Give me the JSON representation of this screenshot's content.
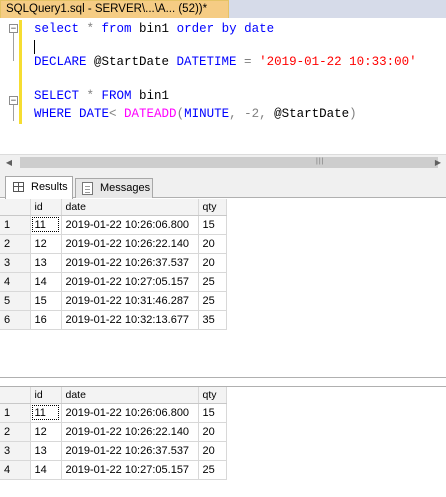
{
  "document_tab": {
    "title": "SQLQuery1.sql - SERVER\\...\\A... (52))*"
  },
  "editor": {
    "line1": {
      "kw1": "select",
      "star": " * ",
      "kw2": "from",
      "ident": " bin1 ",
      "kw3": "order by",
      "kw4": " date"
    },
    "line2": {
      "kw1": "DECLARE",
      "var": " @StartDate ",
      "kw2": "DATETIME",
      "eq": " = ",
      "str": "'2019-01-22 10:33:00'"
    },
    "line3": {
      "kw1": "SELECT",
      "star": " * ",
      "kw2": "FROM",
      "ident": " bin1"
    },
    "line4": {
      "kw1": "WHERE",
      "col": " DATE",
      "op": "< ",
      "fn": "DATEADD",
      "open": "(",
      "arg1": "MINUTE",
      "comma1": ", ",
      "arg2": "-2",
      "comma2": ", ",
      "var": "@StartDate",
      "close": ")"
    },
    "outline_symbol": "−"
  },
  "results_tabs": {
    "results": "Results",
    "messages": "Messages"
  },
  "grid1": {
    "columns": [
      "id",
      "date",
      "qty"
    ],
    "rows": [
      [
        "1",
        "11",
        "2019-01-22 10:26:06.800",
        "15"
      ],
      [
        "2",
        "12",
        "2019-01-22 10:26:22.140",
        "20"
      ],
      [
        "3",
        "13",
        "2019-01-22 10:26:37.537",
        "20"
      ],
      [
        "4",
        "14",
        "2019-01-22 10:27:05.157",
        "25"
      ],
      [
        "5",
        "15",
        "2019-01-22 10:31:46.287",
        "25"
      ],
      [
        "6",
        "16",
        "2019-01-22 10:32:13.677",
        "35"
      ]
    ]
  },
  "grid2": {
    "columns": [
      "id",
      "date",
      "qty"
    ],
    "rows": [
      [
        "1",
        "11",
        "2019-01-22 10:26:06.800",
        "15"
      ],
      [
        "2",
        "12",
        "2019-01-22 10:26:22.140",
        "20"
      ],
      [
        "3",
        "13",
        "2019-01-22 10:26:37.537",
        "20"
      ],
      [
        "4",
        "14",
        "2019-01-22 10:27:05.157",
        "25"
      ]
    ]
  }
}
